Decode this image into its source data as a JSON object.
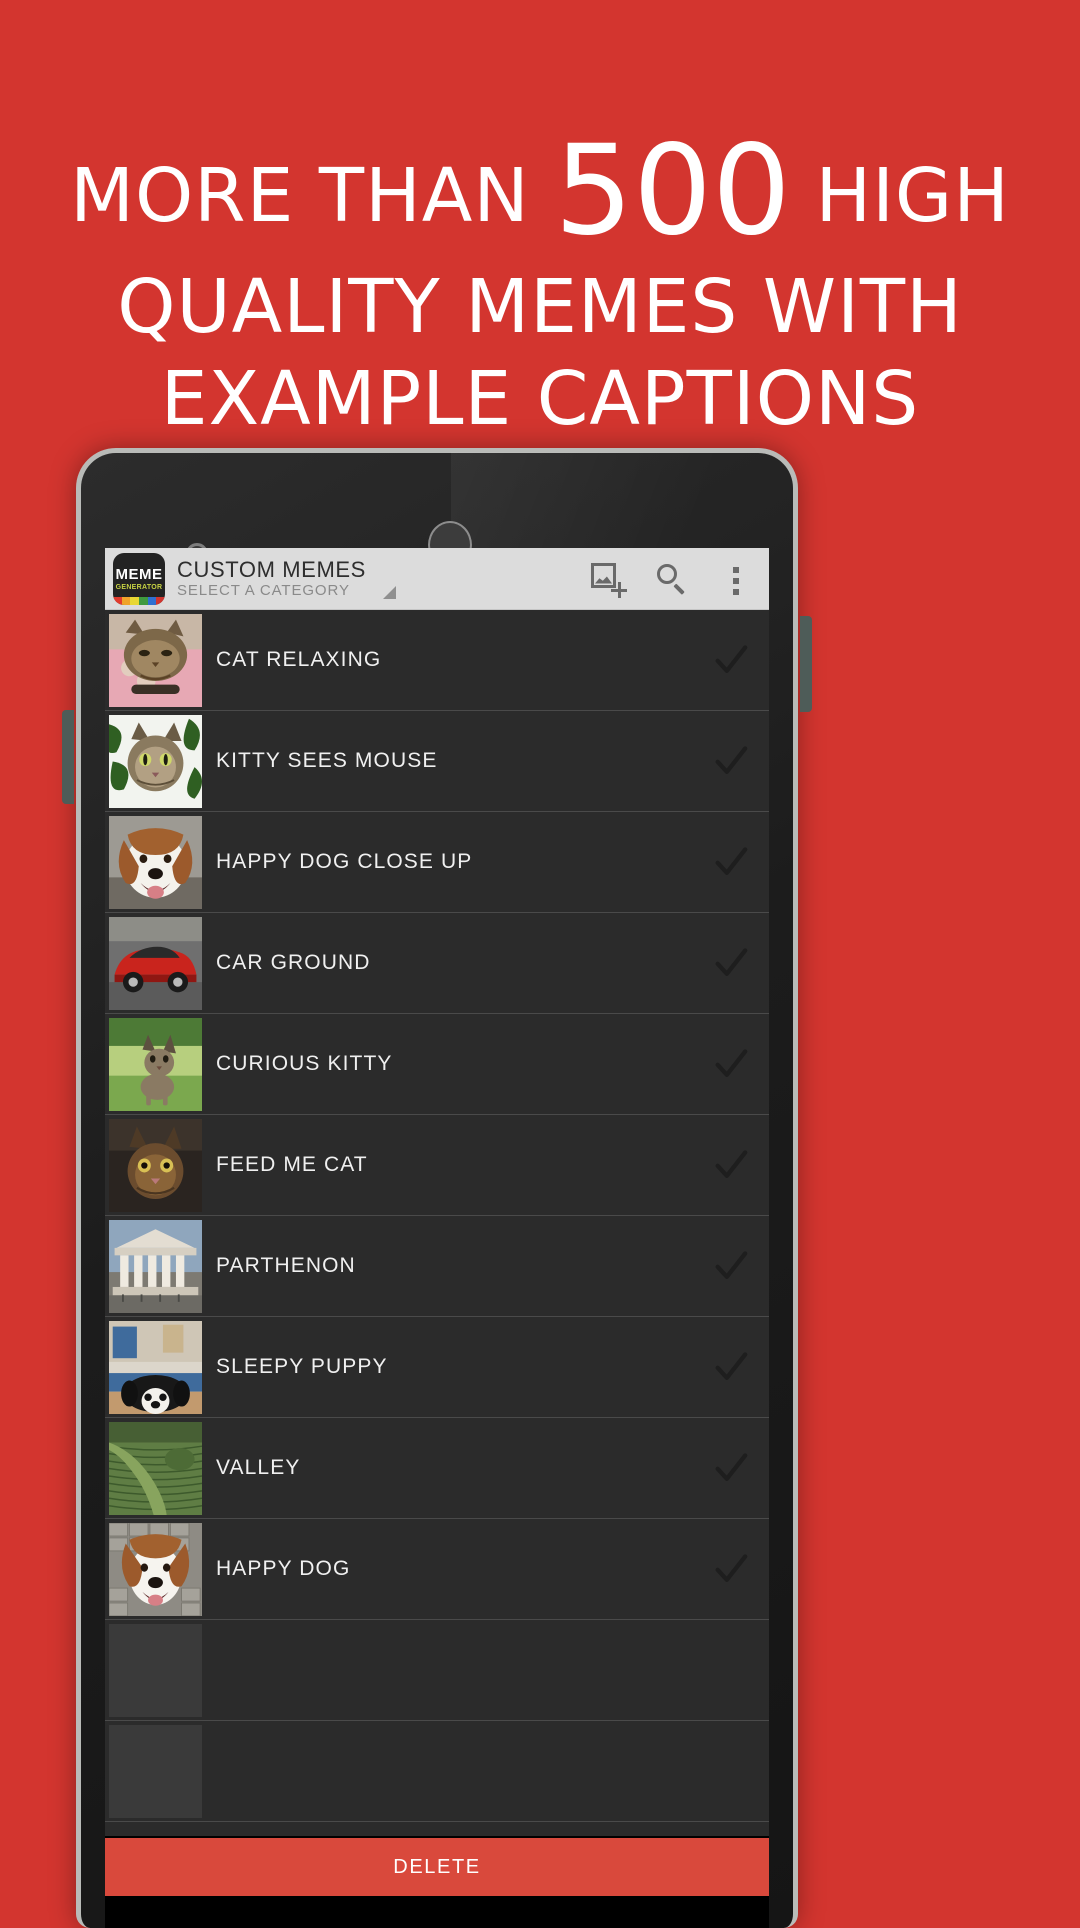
{
  "promo": {
    "line1_prefix": "MORE THAN ",
    "line1_number": "500",
    "line1_suffix": " HIGH",
    "line2": "QUALITY MEMES WITH",
    "line3": "EXAMPLE CAPTIONS"
  },
  "colors": {
    "background": "#d3352f",
    "toolbar": "#dcdcdc",
    "list_background": "#2b2b2b",
    "delete_button": "#d9493c",
    "accent_text": "#ffffff"
  },
  "toolbar": {
    "logo_primary": "MEME",
    "logo_secondary": "GENERATOR",
    "title": "CUSTOM MEMES",
    "subtitle": "SELECT A CATEGORY",
    "actions": [
      {
        "name": "add-image-icon",
        "label": "Add image"
      },
      {
        "name": "search-icon",
        "label": "Search"
      },
      {
        "name": "overflow-menu-icon",
        "label": "More options"
      }
    ]
  },
  "list": {
    "items": [
      {
        "label": "CAT RELAXING",
        "checked": true,
        "thumb": "cat-relaxing"
      },
      {
        "label": "KITTY SEES MOUSE",
        "checked": true,
        "thumb": "kitty-sees-mouse"
      },
      {
        "label": "HAPPY DOG CLOSE UP",
        "checked": true,
        "thumb": "happy-dog-close-up"
      },
      {
        "label": "CAR GROUND",
        "checked": true,
        "thumb": "car-ground"
      },
      {
        "label": "CURIOUS KITTY",
        "checked": true,
        "thumb": "curious-kitty"
      },
      {
        "label": "FEED ME CAT",
        "checked": true,
        "thumb": "feed-me-cat"
      },
      {
        "label": "PARTHENON",
        "checked": true,
        "thumb": "parthenon"
      },
      {
        "label": "SLEEPY PUPPY",
        "checked": true,
        "thumb": "sleepy-puppy"
      },
      {
        "label": "VALLEY",
        "checked": true,
        "thumb": "valley"
      },
      {
        "label": "HAPPY DOG",
        "checked": true,
        "thumb": "happy-dog"
      },
      {
        "label": "",
        "checked": false,
        "thumb": "hidden-row"
      },
      {
        "label": "",
        "checked": false,
        "thumb": "hidden-row"
      }
    ]
  },
  "footer": {
    "delete_label": "DELETE"
  }
}
